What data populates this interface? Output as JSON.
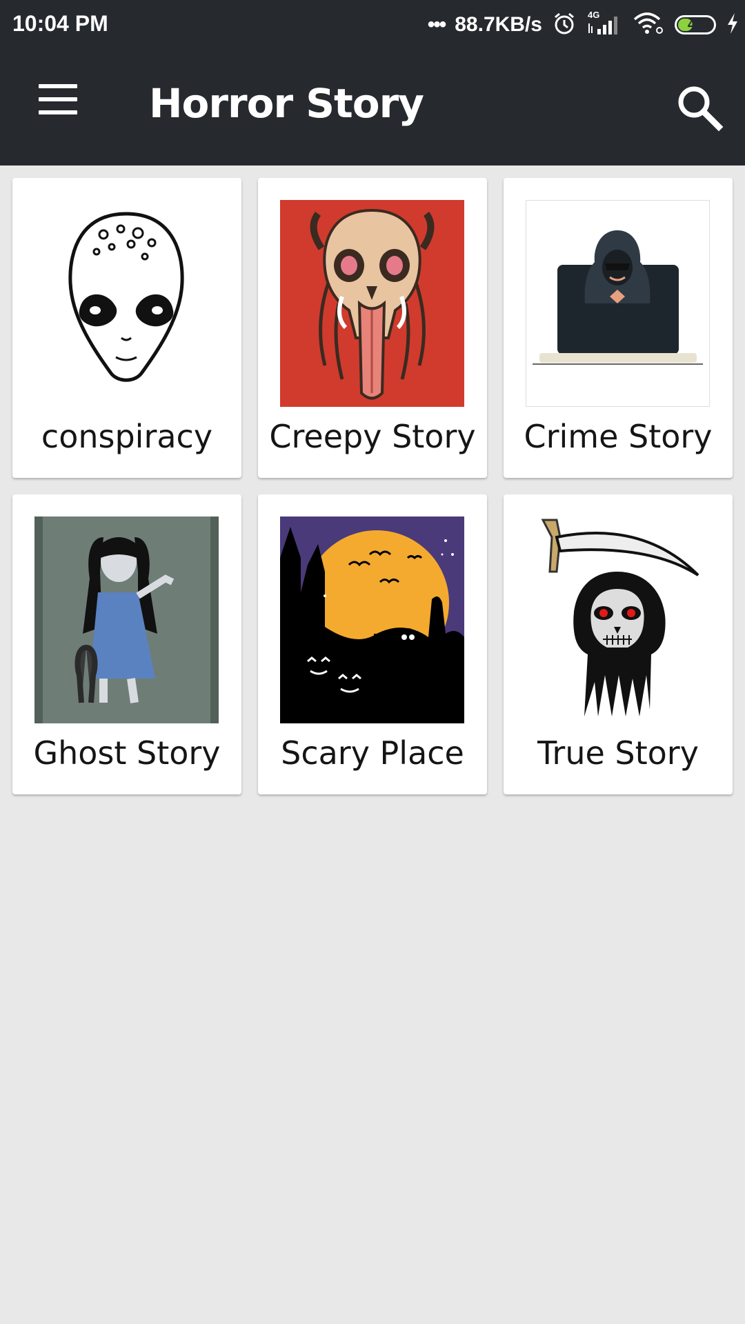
{
  "status_bar": {
    "time": "10:04 PM",
    "network_dots": "•••",
    "net_speed": "88.7KB/s",
    "network_type": "4G",
    "battery_level": "40",
    "battery_fraction": 0.4,
    "battery_color": "#8bd23c",
    "icons": [
      "alarm-icon",
      "signal-icon",
      "wifi-icon",
      "battery-icon",
      "charging-icon"
    ]
  },
  "app_bar": {
    "title": "Horror Story",
    "menu_icon": "menu-icon",
    "search_icon": "search-icon",
    "background": "#262a2f"
  },
  "categories": [
    {
      "label": "conspiracy",
      "image": "alien-head-illustration"
    },
    {
      "label": "Creepy Story",
      "image": "red-skull-illustration"
    },
    {
      "label": "Crime Story",
      "image": "hooded-hacker-laptop-illustration"
    },
    {
      "label": "Ghost Story",
      "image": "ghost-girl-illustration"
    },
    {
      "label": "Scary Place",
      "image": "halloween-graveyard-illustration"
    },
    {
      "label": "True Story",
      "image": "grim-reaper-skull-illustration"
    }
  ]
}
